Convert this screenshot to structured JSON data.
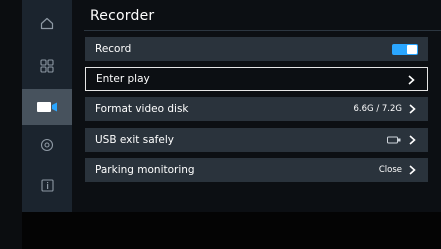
{
  "header": {
    "title": "Recorder"
  },
  "sidebar": {
    "items": [
      {
        "name": "home",
        "icon": "home-icon"
      },
      {
        "name": "apps",
        "icon": "apps-icon"
      },
      {
        "name": "recorder",
        "icon": "video-camera-icon",
        "active": true
      },
      {
        "name": "view",
        "icon": "eye-icon"
      },
      {
        "name": "info",
        "icon": "info-icon"
      }
    ]
  },
  "settings": {
    "record": {
      "label": "Record",
      "enabled": true
    },
    "enter_play": {
      "label": "Enter play"
    },
    "format_disk": {
      "label": "Format video disk",
      "value": "6.6G / 7.2G"
    },
    "usb_exit": {
      "label": "USB exit safely",
      "icon": "usb-drive-icon"
    },
    "parking": {
      "label": "Parking monitoring",
      "value": "Close"
    }
  },
  "colors": {
    "accent": "#2aa6ff",
    "sidebar": "#1b242e",
    "sidebar_active": "#47525d",
    "row_bg": "#2a333c"
  }
}
